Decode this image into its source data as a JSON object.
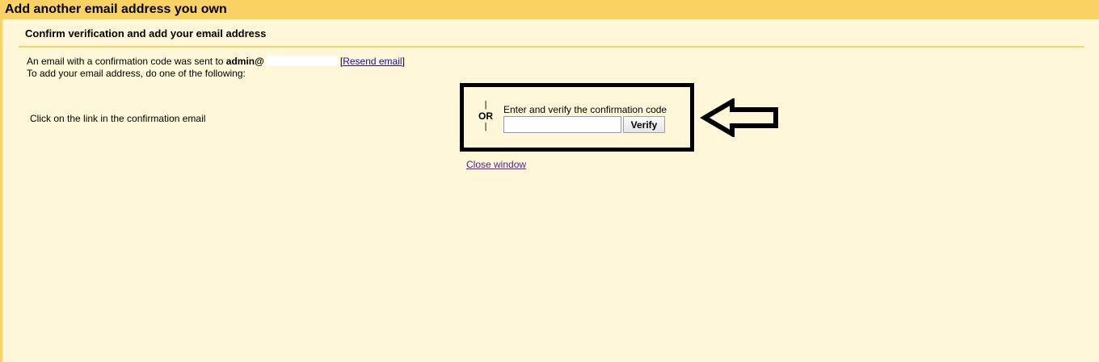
{
  "window": {
    "title": "Add another email address you own"
  },
  "section": {
    "heading": "Confirm verification and add your email address"
  },
  "info": {
    "line1_prefix": "An email with a confirmation code was sent to",
    "email_visible": "admin@",
    "resend_open": "[",
    "resend_link": "Resend email",
    "resend_close": "]",
    "line2": "To add your email address, do one of the following:"
  },
  "options": {
    "click_link_text": "Click on the link in the confirmation email",
    "separator_bar": "|",
    "or_text": "OR",
    "code_label": "Enter and verify the confirmation code",
    "code_value": "",
    "verify_label": "Verify"
  },
  "footer": {
    "close_link": "Close window"
  },
  "icons": {
    "annotation": "arrow-left-icon"
  },
  "colors": {
    "background": "#fff7d7",
    "accent": "#fad163",
    "link": "#1a0dab",
    "visited_link": "#551a8b",
    "annotation": "#000000"
  }
}
